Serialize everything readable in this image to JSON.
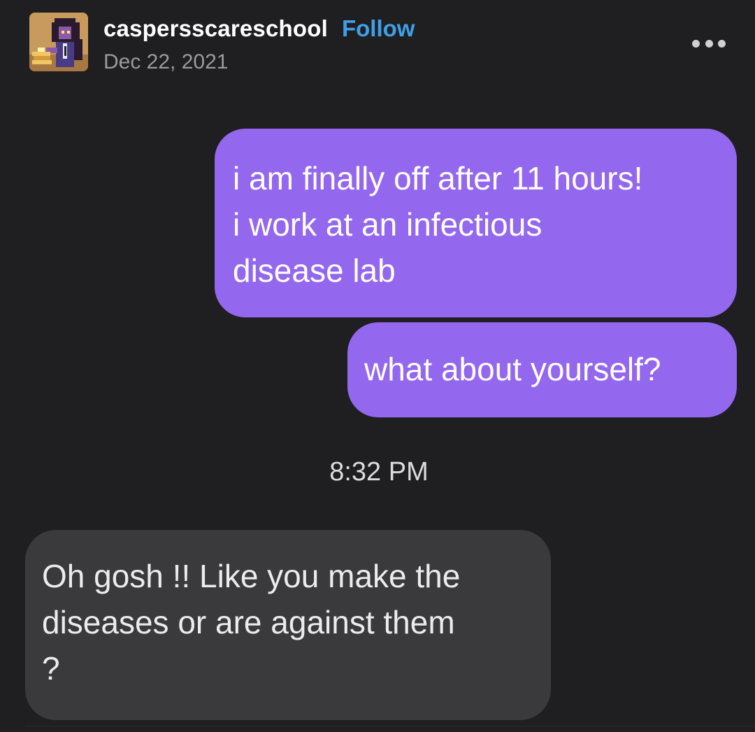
{
  "header": {
    "username": "caspersscareschool",
    "follow_label": "Follow",
    "date": "Dec 22, 2021",
    "avatar_icon": "pixel-art-avatar",
    "more_icon": "more-options-icon"
  },
  "messages": {
    "sent_1": {
      "lines": [
        "i am finally off after 11 hours!",
        "i work at an infectious",
        "disease lab"
      ]
    },
    "sent_2": {
      "text": "what about yourself?"
    },
    "timestamp": "8:32 PM",
    "received_1": {
      "lines": [
        "Oh gosh !! Like you make the",
        "diseases or are against them",
        "?"
      ]
    }
  },
  "colors": {
    "background": "#1f1f21",
    "sent_bubble": "#9467ef",
    "received_bubble": "#3a3a3c",
    "follow_link": "#3ea0e8",
    "date_text": "#9a9a9e"
  }
}
